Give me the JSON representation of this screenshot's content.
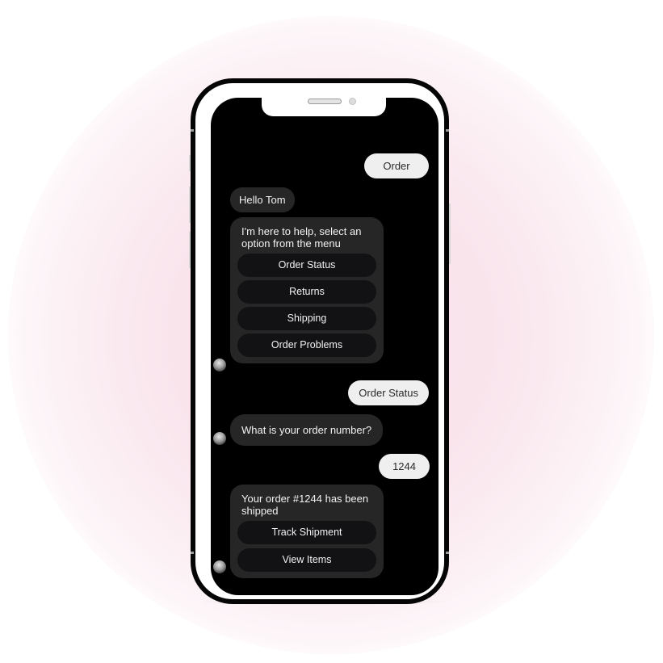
{
  "colors": {
    "background_glow": "#f8e0ea",
    "phone_frame": "#050505",
    "screen": "#000000",
    "user_bubble": "#efefef",
    "bot_bubble": "#262626",
    "option_button": "#121214"
  },
  "chat": {
    "messages": [
      {
        "from": "user",
        "text": "Order"
      },
      {
        "from": "bot",
        "text": "Hello Tom"
      },
      {
        "from": "bot",
        "text": "I'm here to help, select an option from the menu",
        "options": [
          "Order Status",
          "Returns",
          "Shipping",
          "Order Problems"
        ],
        "avatar": "bot-avatar-icon"
      },
      {
        "from": "user",
        "text": "Order Status"
      },
      {
        "from": "bot",
        "text": "What is your order number?",
        "avatar": "bot-avatar-icon"
      },
      {
        "from": "user",
        "text": "1244"
      },
      {
        "from": "bot",
        "text": "Your order #1244 has been shipped",
        "options": [
          "Track Shipment",
          "View Items"
        ],
        "avatar": "bot-avatar-icon"
      }
    ]
  }
}
